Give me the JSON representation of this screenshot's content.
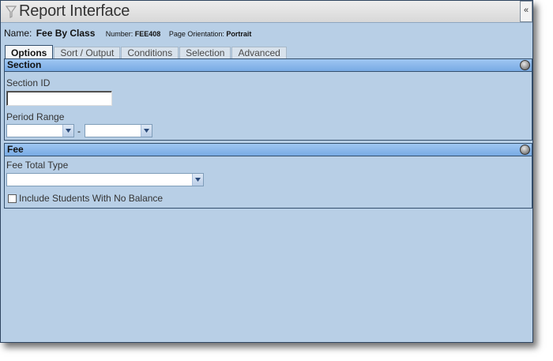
{
  "window": {
    "title": "Report Interface",
    "collapse_icon": "«"
  },
  "report": {
    "name_label": "Name:",
    "name_value": "Fee By Class",
    "number_label": "Number:",
    "number_value": "FEE408",
    "orientation_label": "Page Orientation:",
    "orientation_value": "Portrait"
  },
  "tabs": [
    {
      "label": "Options",
      "active": true
    },
    {
      "label": "Sort / Output"
    },
    {
      "label": "Conditions"
    },
    {
      "label": "Selection"
    },
    {
      "label": "Advanced"
    }
  ],
  "section_panel": {
    "title": "Section",
    "section_id_label": "Section ID",
    "section_id_value": "",
    "period_range_label": "Period Range",
    "period_from": "",
    "period_to": "",
    "range_separator": "-"
  },
  "fee_panel": {
    "title": "Fee",
    "fee_total_type_label": "Fee Total Type",
    "fee_total_type_value": "",
    "include_no_balance_label": "Include Students With No Balance",
    "include_no_balance_checked": false
  }
}
